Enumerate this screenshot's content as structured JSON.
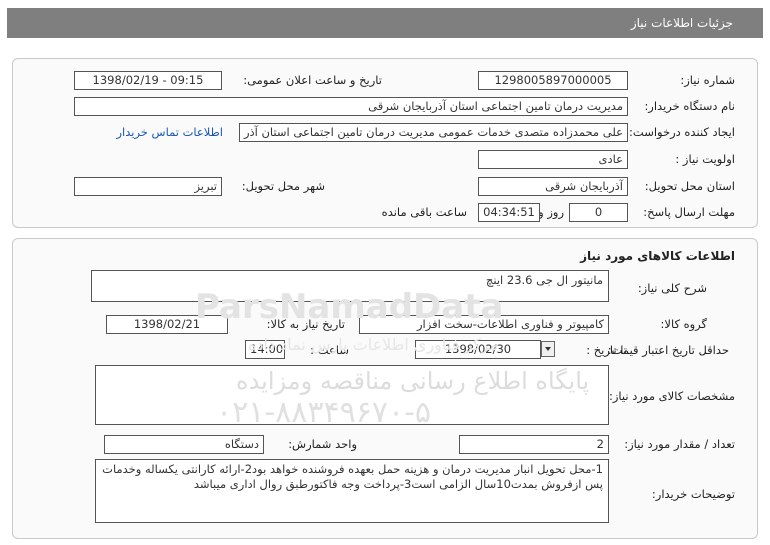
{
  "header": {
    "title": "جزئیات اطلاعات نیاز"
  },
  "watermark": {
    "brand": "ParsNamadData",
    "line1": "پایگاه اطلاع رسانی مناقصه ومزایده",
    "line2": "۰۲۱-۸۸۳۴۹۶۷۰-۵",
    "line3": "مرکز فناوری اطلاعات پارس نماد داده"
  },
  "info": {
    "need_number_label": "شماره نیاز:",
    "need_number": "1298005897000005",
    "announce_label": "تاریخ و ساعت اعلان عمومی:",
    "announce_value": "1398/02/19 - 09:15",
    "buyer_label": "نام دستگاه خریدار:",
    "buyer": "مدیریت درمان تامین اجتماعی استان آذربایجان شرقی",
    "requester_label": "ایجاد کننده درخواست:",
    "requester": "علی محمدزاده متصدی خدمات عمومی مدیریت درمان تامین اجتماعی استان آذر",
    "contact_link": "اطلاعات تماس خریدار",
    "priority_label": "اولویت نیاز :",
    "priority": "عادی",
    "province_label": "استان محل تحویل:",
    "province": "آذربایجان شرقی",
    "city_label": "شهر محل تحویل:",
    "city": "تبریز",
    "deadline_label": "مهلت ارسال پاسخ:",
    "days": "0",
    "days_unit": "روز و",
    "time_left": "04:34:51",
    "time_left_unit": "ساعت باقی مانده"
  },
  "goods": {
    "title": "اطلاعات کالاهای مورد نیاز",
    "summary_label": "شرح کلی نیاز:",
    "summary": "مانیتور ال جی 23.6 اینچ",
    "group_label": "گروه کالا:",
    "group": "کامپیوتر و فناوری اطلاعات-سخت افزار",
    "need_date_label": "تاریخ نیاز به کالا:",
    "need_date": "1398/02/21",
    "validity_label": "حداقل تاریخ اعتبار قیمت:",
    "validity_until": "تا تاریخ :",
    "validity_date": "1398/02/30",
    "validity_time_label": "ساعت :",
    "validity_time": "14:00",
    "specs_label": "مشخصات کالای مورد نیاز:",
    "specs": "",
    "qty_label": "تعداد / مقدار مورد نیاز:",
    "qty": "2",
    "unit_label": "واحد شمارش:",
    "unit": "دستگاه",
    "notes_label": "توضیحات خریدار:",
    "notes": "1-محل تحویل انبار مدیریت درمان و هزینه حمل بعهده فروشنده خواهد بود2-ارائه کارانتی یکساله وخدمات پس ازفروش بمدت10سال الزامی است3-پرداخت وجه فاکتورطبق روال اداری میباشد"
  }
}
